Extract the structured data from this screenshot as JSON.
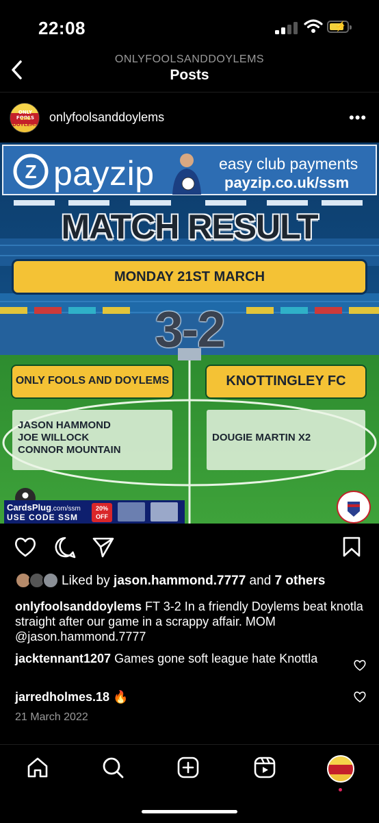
{
  "status_bar": {
    "time": "22:08",
    "battery_color": "#f3d13c"
  },
  "header": {
    "account_caption": "ONLYFOOLSANDDOYLEMS",
    "title": "Posts"
  },
  "post": {
    "username": "onlyfoolsanddoylems",
    "avatar_text_top": "ONLY FOOLS",
    "avatar_text_mid": "and",
    "avatar_text_bottom": "DOYLEMS",
    "image": {
      "ad_brand": "payzip",
      "ad_tagline": "easy club payments",
      "ad_url": "payzip.co.uk/ssm",
      "heading": "MATCH RESULT",
      "date": "MONDAY 21ST MARCH",
      "score": "3-2",
      "home_team": "ONLY FOOLS AND DOYLEMS",
      "away_team": "KNOTTINGLEY FC",
      "home_scorers": [
        "JASON HAMMOND",
        "JOE WILLOCK",
        "CONNOR MOUNTAIN"
      ],
      "away_scorers": [
        "DOUGIE MARTIN X2"
      ],
      "cards_brand": "CardsPlug",
      "cards_url": ".com/ssm",
      "cards_code": "USE CODE SSM",
      "cards_badge": "20% OFF",
      "badge_text": "SOCIAL SPORTS MANAGER"
    },
    "likes": {
      "prefix": "Liked by ",
      "user": "jason.hammond.7777",
      "middle": " and ",
      "others": "7 others"
    },
    "caption": {
      "user": "onlyfoolsanddoylems",
      "text": " FT 3-2 In a friendly Doylems beat knotla straight after our game in a scrappy affair. MOM @jason.hammond.7777"
    },
    "comments": [
      {
        "user": "jacktennant1207",
        "text": " Games gone soft league hate Knottla"
      },
      {
        "user": "jarredholmes.18",
        "text": " 🔥"
      }
    ],
    "date": "21 March 2022"
  },
  "icons": {
    "back": "chevron-left-icon",
    "more": "more-icon",
    "like": "heart-icon",
    "comment": "comment-icon",
    "share": "send-icon",
    "save": "bookmark-icon",
    "nav": [
      "home-icon",
      "search-icon",
      "create-icon",
      "reels-icon",
      "profile-avatar"
    ]
  }
}
